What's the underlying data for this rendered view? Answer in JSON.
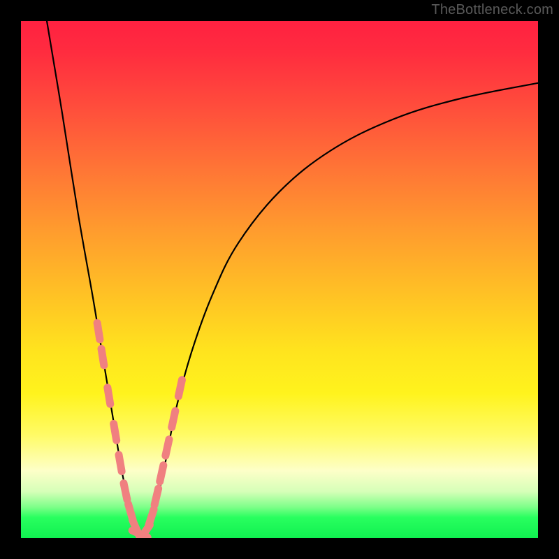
{
  "watermark": "TheBottleneck.com",
  "colors": {
    "frame": "#000000",
    "curve": "#000000",
    "marker_fill": "#f08080",
    "marker_stroke": "#f08080",
    "gradient_stops": [
      "#ff2141",
      "#ff2c3f",
      "#ff4b3c",
      "#ff7336",
      "#ff9a2e",
      "#ffc524",
      "#ffe41e",
      "#fff31d",
      "#fffb65",
      "#fdffc8",
      "#d6ffb8",
      "#7eff89",
      "#29ff5f",
      "#10f050"
    ]
  },
  "chart_data": {
    "type": "line",
    "title": "",
    "xlabel": "",
    "ylabel": "",
    "xlim": [
      0,
      100
    ],
    "ylim": [
      0,
      100
    ],
    "grid": false,
    "legend": false,
    "note": "Y represents bottleneck percentage (top=red=high, bottom=green=low). X represents a component ratio. The V-shaped curve shows bottleneck vs. ratio with a minimum near x≈23. Values estimated from pixels.",
    "series": [
      {
        "name": "bottleneck-curve",
        "x": [
          5,
          8,
          11,
          14,
          16,
          18,
          19.5,
          21,
          22,
          23,
          24,
          25,
          26.5,
          28,
          30,
          33,
          37,
          42,
          50,
          60,
          72,
          85,
          100
        ],
        "y": [
          100,
          82,
          63,
          46,
          34,
          22,
          13,
          6,
          2,
          0.5,
          0.6,
          2.5,
          8,
          15,
          25,
          36,
          47,
          57,
          67,
          75,
          81,
          85,
          88
        ]
      }
    ],
    "markers": {
      "name": "highlighted-points",
      "style": "rounded-pill",
      "color": "#f08080",
      "points_note": "Clusters of salmon markers along the curve near the minimum, estimated positions.",
      "x": [
        15.0,
        15.8,
        17.0,
        18.2,
        19.2,
        20.2,
        21.2,
        22.2,
        23.0,
        24.0,
        25.2,
        26.2,
        27.2,
        28.3,
        29.5,
        30.8
      ],
      "y": [
        40.0,
        35.0,
        27.5,
        20.5,
        14.5,
        9.0,
        5.0,
        2.0,
        0.8,
        1.2,
        4.0,
        8.0,
        12.5,
        17.5,
        23.0,
        29.0
      ]
    }
  }
}
